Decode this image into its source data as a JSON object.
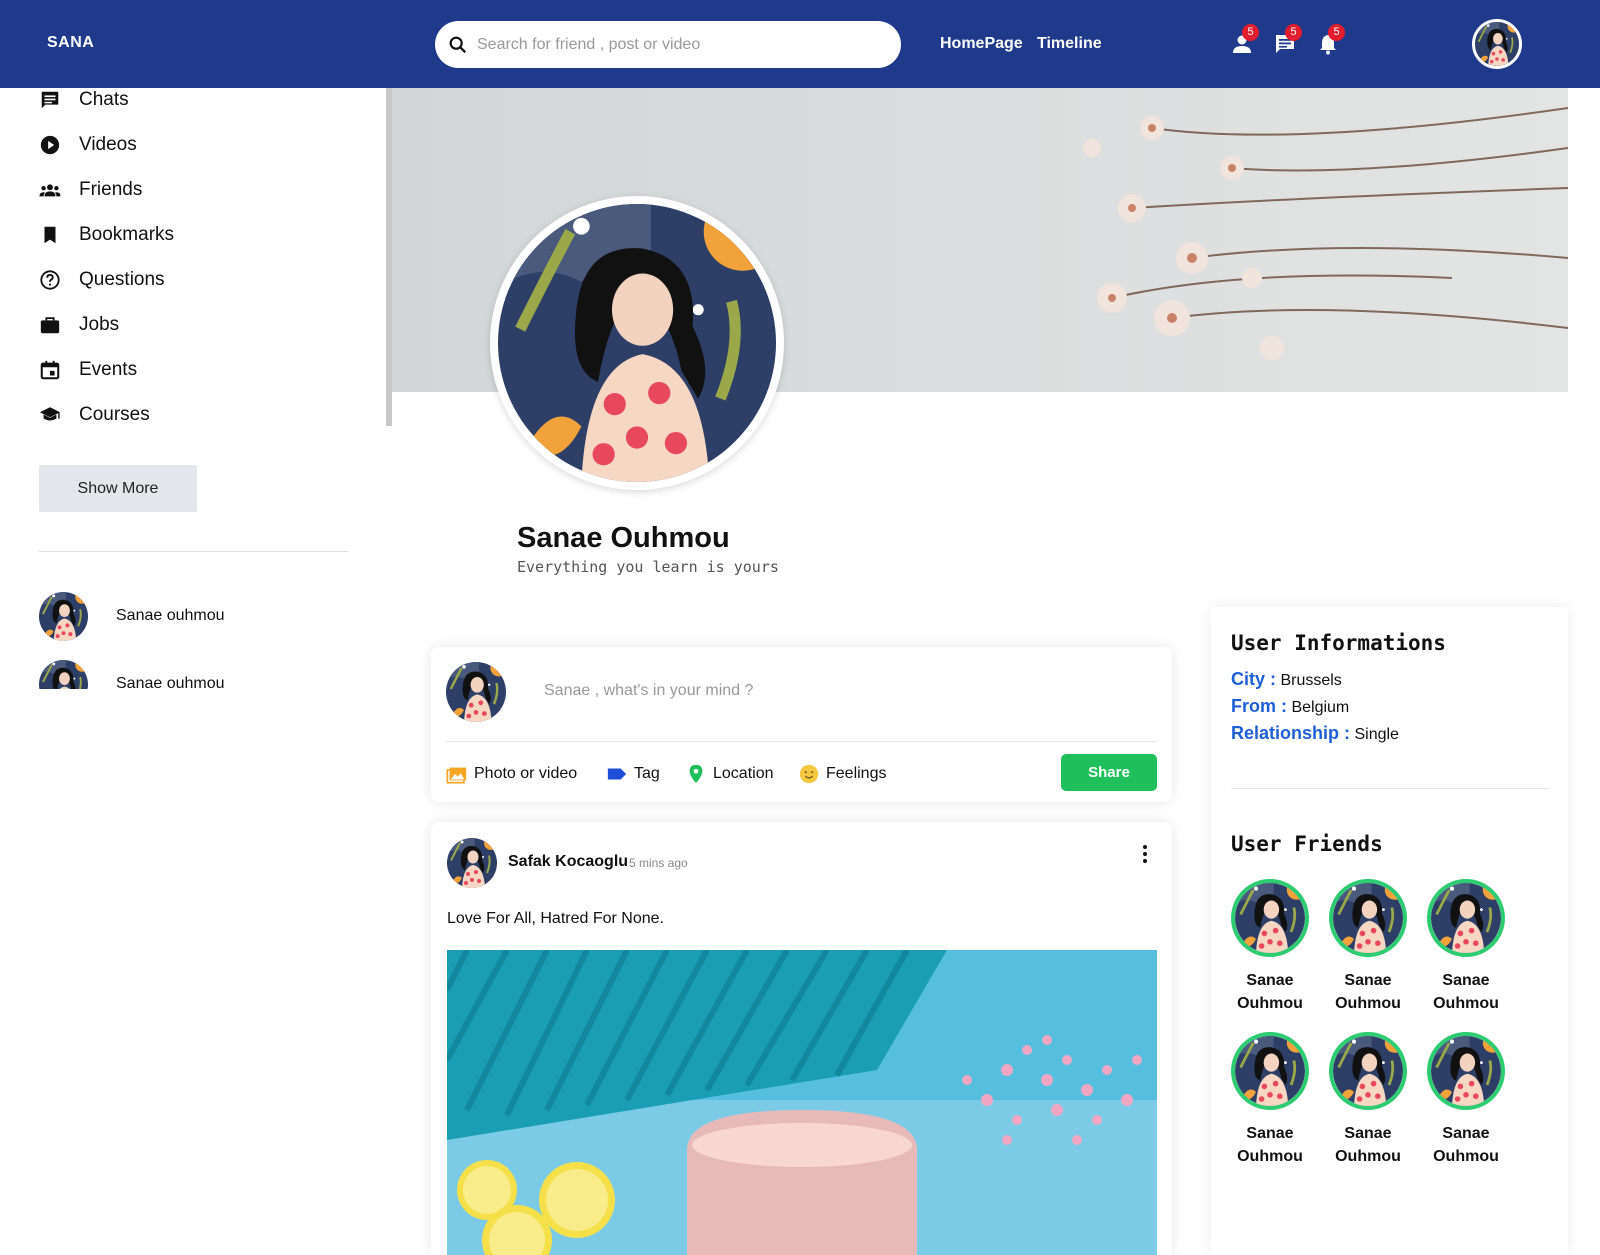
{
  "header": {
    "logo": "SANA",
    "search_placeholder": "Search for friend , post or video",
    "nav": [
      {
        "label": "HomePage"
      },
      {
        "label": "Timeline"
      }
    ],
    "badges": {
      "friends": "5",
      "messages": "5",
      "notifications": "5"
    }
  },
  "sidebar": {
    "items": [
      {
        "label": "Chats",
        "icon": "chat-icon"
      },
      {
        "label": "Videos",
        "icon": "play-circle-icon"
      },
      {
        "label": "Friends",
        "icon": "group-icon"
      },
      {
        "label": "Bookmarks",
        "icon": "bookmark-icon"
      },
      {
        "label": "Questions",
        "icon": "question-icon"
      },
      {
        "label": "Jobs",
        "icon": "briefcase-icon"
      },
      {
        "label": "Events",
        "icon": "calendar-icon"
      },
      {
        "label": "Courses",
        "icon": "graduation-cap-icon"
      }
    ],
    "show_more": "Show More",
    "friends": [
      {
        "name": "Sanae ouhmou"
      },
      {
        "name": "Sanae ouhmou"
      }
    ]
  },
  "profile": {
    "name": "Sanae Ouhmou",
    "description": "Everything you learn is yours"
  },
  "share": {
    "placeholder": "Sanae , what's in your mind ?",
    "options": [
      {
        "label": "Photo or video",
        "icon": "photo-icon",
        "color": "#f5a623"
      },
      {
        "label": "Tag",
        "icon": "label-icon",
        "color": "#1f4fd6"
      },
      {
        "label": "Location",
        "icon": "location-pin-icon",
        "color": "#1fbf5b"
      },
      {
        "label": "Feelings",
        "icon": "emoji-icon",
        "color": "#f5c842"
      }
    ],
    "button": "Share"
  },
  "post": {
    "author": "Safak Kocaoglu",
    "time": "5 mins ago",
    "text": "Love For All, Hatred For None."
  },
  "user_info": {
    "title": "User Informations",
    "city_label": "City :",
    "city": "Brussels",
    "from_label": "From :",
    "from": "Belgium",
    "relationship_label": "Relationship :",
    "relationship": "Single"
  },
  "user_friends": {
    "title": "User Friends",
    "items": [
      {
        "first": "Sanae",
        "last": "Ouhmou"
      },
      {
        "first": "Sanae",
        "last": "Ouhmou"
      },
      {
        "first": "Sanae",
        "last": "Ouhmou"
      },
      {
        "first": "Sanae",
        "last": "Ouhmou"
      },
      {
        "first": "Sanae",
        "last": "Ouhmou"
      },
      {
        "first": "Sanae",
        "last": "Ouhmou"
      }
    ]
  },
  "colors": {
    "header_bg": "#1f3a8a",
    "accent_blue": "#1f5fd6",
    "share_green": "#1fbf5b",
    "badge_red": "#e11d2e",
    "friend_ring": "#2ecc71"
  }
}
